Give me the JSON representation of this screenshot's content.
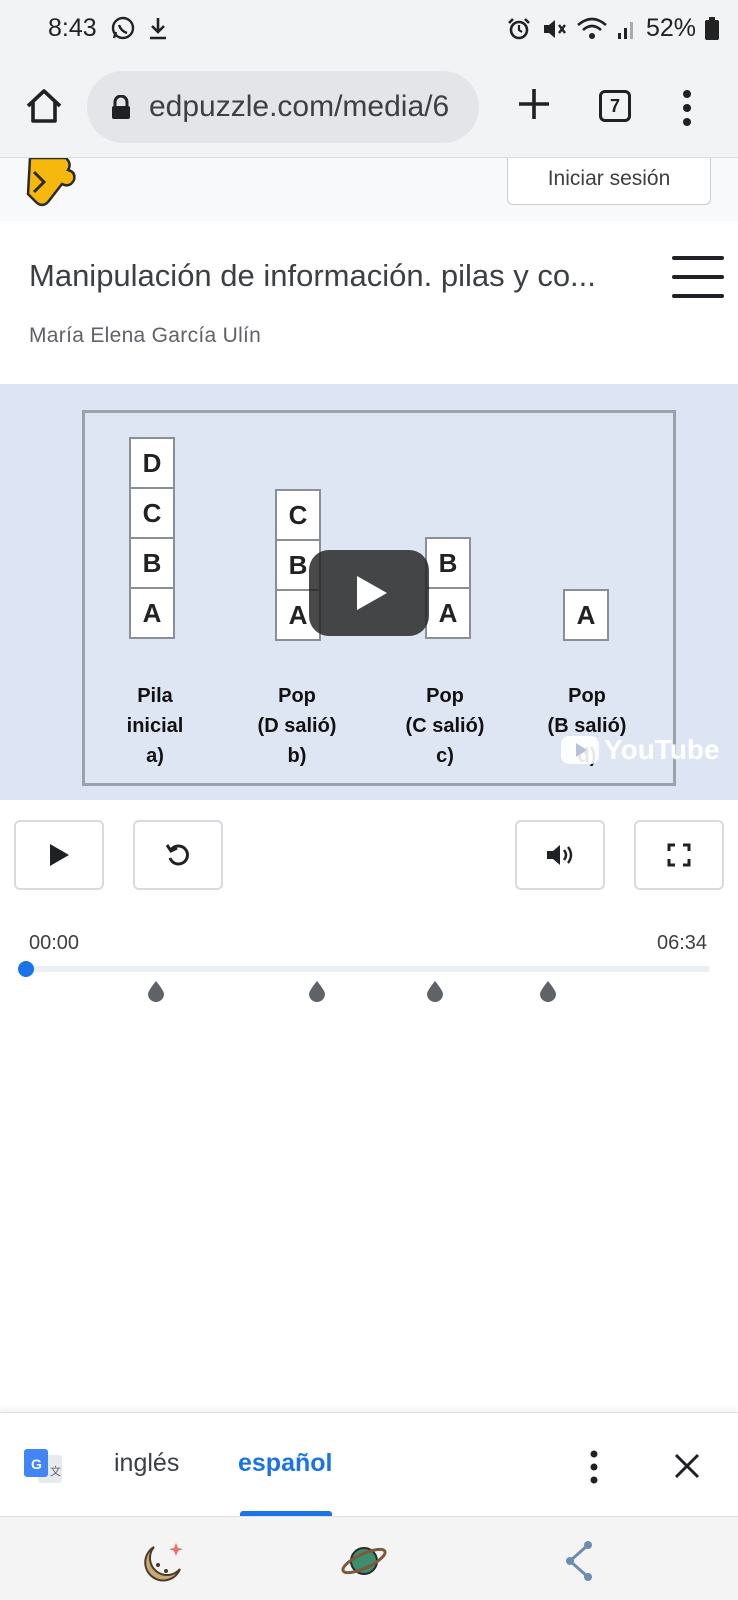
{
  "status_bar": {
    "time": "8:43",
    "battery": "52%",
    "icons_left": [
      "whatsapp-icon",
      "download-icon"
    ],
    "icons_right": [
      "alarm-icon",
      "mute-icon",
      "wifi-icon",
      "signal-icon",
      "battery-icon"
    ]
  },
  "browser": {
    "url": "edpuzzle.com/media/6",
    "tab_count": "7"
  },
  "site": {
    "signin_label": "Iniciar sesión",
    "title": "Manipulación de información. pilas y co...",
    "author": "María Elena García Ulín"
  },
  "slide": {
    "stacks": [
      {
        "cells": [
          "D",
          "C",
          "B",
          "A"
        ],
        "caption": [
          "Pila",
          "inicial",
          "a)"
        ]
      },
      {
        "cells": [
          "C",
          "B",
          "A"
        ],
        "caption": [
          "Pop",
          "(D salió)",
          "b)"
        ]
      },
      {
        "cells": [
          "B",
          "A"
        ],
        "caption": [
          "Pop",
          "(C salió)",
          "c)"
        ]
      },
      {
        "cells": [
          "A"
        ],
        "caption": [
          "Pop",
          "(B salió)",
          "d)"
        ]
      }
    ],
    "watermark": "YouTube"
  },
  "player": {
    "current_time": "00:00",
    "duration": "06:34",
    "progress_fraction": 0.0,
    "question_markers": [
      "marker-1",
      "marker-2",
      "marker-3",
      "marker-4"
    ],
    "accent_color": "#1a73e8"
  },
  "translate": {
    "source_lang": "inglés",
    "target_lang": "español"
  },
  "nav": {
    "icons": [
      "moon-sticker-icon",
      "planet-icon",
      "share-icon"
    ]
  }
}
